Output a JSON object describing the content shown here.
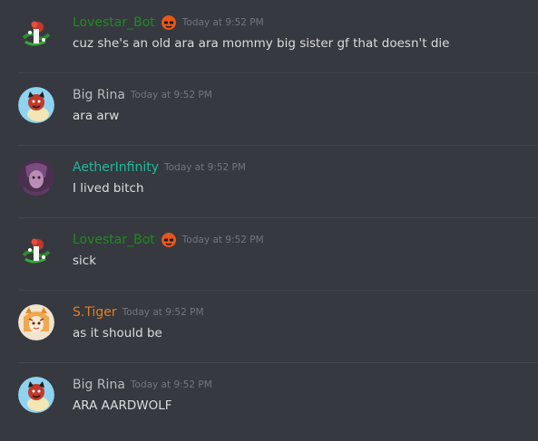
{
  "colors": {
    "background": "#36393f",
    "divider": "#42454a",
    "text": "#dcddde",
    "timestamp": "#72767d"
  },
  "messages": [
    {
      "author": "Lovestar_Bot",
      "author_color": "#1f8b1f",
      "avatar_icon": "rose-avatar-icon",
      "bot_badge": "fox-mask-icon",
      "timestamp": "Today at 9:52 PM",
      "text": "cuz she's an old ara ara mommy big sister gf that doesn't die"
    },
    {
      "author": "Big Rina",
      "author_color": "#b9bbbe",
      "avatar_icon": "red-panda-avatar-icon",
      "timestamp": "Today at 9:52 PM",
      "text": "ara arw"
    },
    {
      "author": "AetherInfinity",
      "author_color": "#1abc9c",
      "avatar_icon": "purple-character-avatar-icon",
      "timestamp": "Today at 9:52 PM",
      "text": "I lived bitch"
    },
    {
      "author": "Lovestar_Bot",
      "author_color": "#1f8b1f",
      "avatar_icon": "rose-avatar-icon",
      "bot_badge": "fox-mask-icon",
      "timestamp": "Today at 9:52 PM",
      "text": "sick"
    },
    {
      "author": "S.Tiger",
      "author_color": "#e67e22",
      "avatar_icon": "tiger-girl-avatar-icon",
      "timestamp": "Today at 9:52 PM",
      "text": "as it should be"
    },
    {
      "author": "Big Rina",
      "author_color": "#b9bbbe",
      "avatar_icon": "red-panda-avatar-icon",
      "timestamp": "Today at 9:52 PM",
      "text": "ARA AARDWOLF"
    }
  ]
}
